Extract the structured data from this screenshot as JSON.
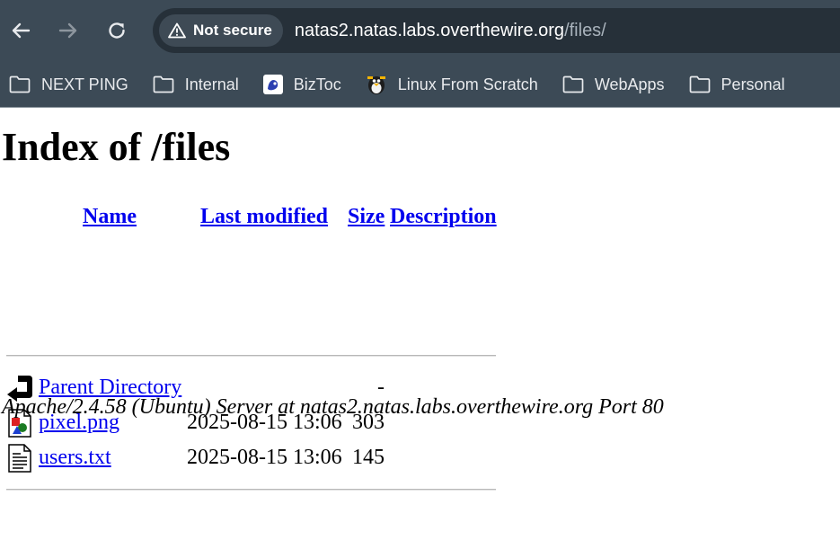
{
  "browser": {
    "security_chip": "Not secure",
    "url_host": "natas2.natas.labs.overthewire.org",
    "url_path": "/files/",
    "bookmarks": [
      {
        "label": "NEXT PING",
        "icon": "folder-icon"
      },
      {
        "label": "Internal",
        "icon": "folder-icon"
      },
      {
        "label": "BizToc",
        "icon": "biztoc-favicon"
      },
      {
        "label": "Linux From Scratch",
        "icon": "lfs-favicon"
      },
      {
        "label": "WebApps",
        "icon": "folder-icon"
      },
      {
        "label": "Personal",
        "icon": "folder-icon"
      }
    ]
  },
  "page": {
    "title": "Index of /files",
    "columns": {
      "name": "Name",
      "last_modified": "Last modified",
      "size": "Size",
      "description": "Description"
    },
    "rows": [
      {
        "name": "Parent Directory",
        "date": "",
        "size": "-",
        "icon": "back-arrow-icon"
      },
      {
        "name": "pixel.png",
        "date": "2025-08-15 13:06",
        "size": "303",
        "icon": "image-file-icon"
      },
      {
        "name": "users.txt",
        "date": "2025-08-15 13:06",
        "size": "145",
        "icon": "text-file-icon"
      }
    ],
    "footer": "Apache/2.4.58 (Ubuntu) Server at natas2.natas.labs.overthewire.org Port 80"
  }
}
